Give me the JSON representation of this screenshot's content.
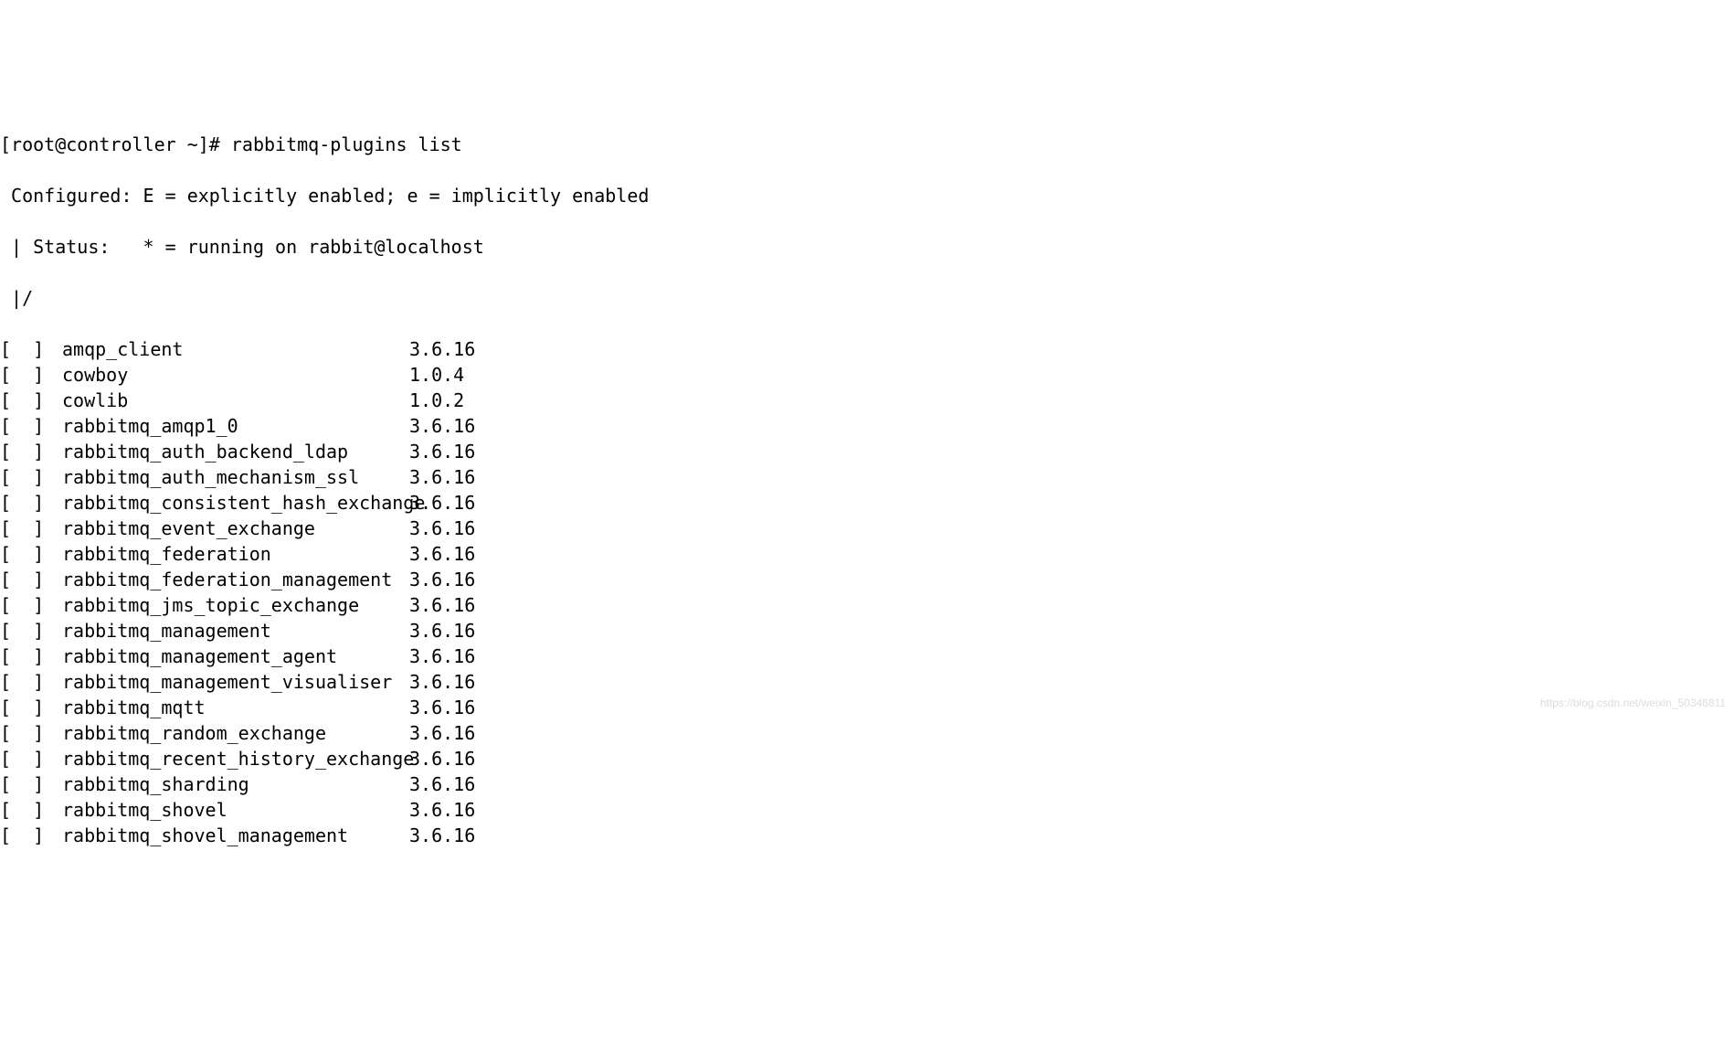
{
  "prompt": "[root@controller ~]# rabbitmq-plugins list",
  "header1": " Configured: E = explicitly enabled; e = implicitly enabled",
  "header2": " | Status:   * = running on rabbit@localhost",
  "header3": " |/",
  "status_bracket": "[  ] ",
  "plugins": [
    {
      "name": "amqp_client",
      "version": "3.6.16"
    },
    {
      "name": "cowboy",
      "version": "1.0.4"
    },
    {
      "name": "cowlib",
      "version": "1.0.2"
    },
    {
      "name": "rabbitmq_amqp1_0",
      "version": "3.6.16"
    },
    {
      "name": "rabbitmq_auth_backend_ldap",
      "version": "3.6.16"
    },
    {
      "name": "rabbitmq_auth_mechanism_ssl",
      "version": "3.6.16"
    },
    {
      "name": "rabbitmq_consistent_hash_exchange",
      "version": "3.6.16"
    },
    {
      "name": "rabbitmq_event_exchange",
      "version": "3.6.16"
    },
    {
      "name": "rabbitmq_federation",
      "version": "3.6.16"
    },
    {
      "name": "rabbitmq_federation_management",
      "version": "3.6.16"
    },
    {
      "name": "rabbitmq_jms_topic_exchange",
      "version": "3.6.16"
    },
    {
      "name": "rabbitmq_management",
      "version": "3.6.16"
    },
    {
      "name": "rabbitmq_management_agent",
      "version": "3.6.16"
    },
    {
      "name": "rabbitmq_management_visualiser",
      "version": "3.6.16"
    },
    {
      "name": "rabbitmq_mqtt",
      "version": "3.6.16"
    },
    {
      "name": "rabbitmq_random_exchange",
      "version": "3.6.16"
    },
    {
      "name": "rabbitmq_recent_history_exchange",
      "version": "3.6.16"
    },
    {
      "name": "rabbitmq_sharding",
      "version": "3.6.16"
    },
    {
      "name": "rabbitmq_shovel",
      "version": "3.6.16"
    },
    {
      "name": "rabbitmq_shovel_management",
      "version": "3.6.16"
    }
  ],
  "watermark": "https://blog.csdn.net/weixin_50346811"
}
